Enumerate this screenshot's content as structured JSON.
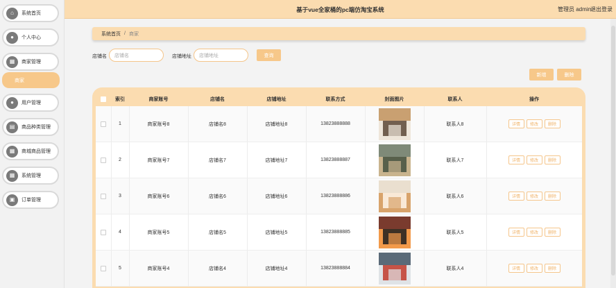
{
  "header": {
    "title": "基于vue全家桶的pc端仿淘宝系统",
    "user": "管理员 admin",
    "logout": "退出登录"
  },
  "sidebar": {
    "items": [
      {
        "label": "系统首页",
        "icon": "home-icon"
      },
      {
        "label": "个人中心",
        "icon": "person-icon"
      },
      {
        "label": "商家管理",
        "icon": "store-icon"
      },
      {
        "label": "用户管理",
        "icon": "user-icon"
      },
      {
        "label": "商品种类管理",
        "icon": "category-icon"
      },
      {
        "label": "商城商品管理",
        "icon": "grid-icon"
      },
      {
        "label": "系统管理",
        "icon": "grid-icon"
      },
      {
        "label": "订单管理",
        "icon": "order-icon"
      }
    ],
    "sub_item": "商家"
  },
  "breadcrumb": {
    "home": "系统首页",
    "separator": "/",
    "current": "商家"
  },
  "search": {
    "shop_name_label": "店铺名",
    "shop_name_placeholder": "店铺名",
    "shop_addr_label": "店铺地址",
    "shop_addr_placeholder": "店铺地址",
    "button": "查询"
  },
  "toolbar": {
    "add": "新增",
    "delete": "删除"
  },
  "table": {
    "headers": [
      "索引",
      "商家账号",
      "店铺名",
      "店铺地址",
      "联系方式",
      "封面图片",
      "联系人",
      "操作"
    ],
    "actions": [
      "详情",
      "修改",
      "删除"
    ],
    "rows": [
      {
        "index": "1",
        "account": "商家账号8",
        "shop": "店铺名8",
        "address": "店铺地址8",
        "phone": "13823888888",
        "contact": "联系人8"
      },
      {
        "index": "2",
        "account": "商家账号7",
        "shop": "店铺名7",
        "address": "店铺地址7",
        "phone": "13823888887",
        "contact": "联系人7"
      },
      {
        "index": "3",
        "account": "商家账号6",
        "shop": "店铺名6",
        "address": "店铺地址6",
        "phone": "13823888886",
        "contact": "联系人6"
      },
      {
        "index": "4",
        "account": "商家账号5",
        "shop": "店铺名5",
        "address": "店铺地址5",
        "phone": "13823888885",
        "contact": "联系人5"
      },
      {
        "index": "5",
        "account": "商家账号4",
        "shop": "店铺名4",
        "address": "店铺地址4",
        "phone": "13823888884",
        "contact": "联系人4"
      }
    ]
  },
  "colors": {
    "accent": "#f7c88a",
    "header_bg": "#fbdcb0"
  }
}
